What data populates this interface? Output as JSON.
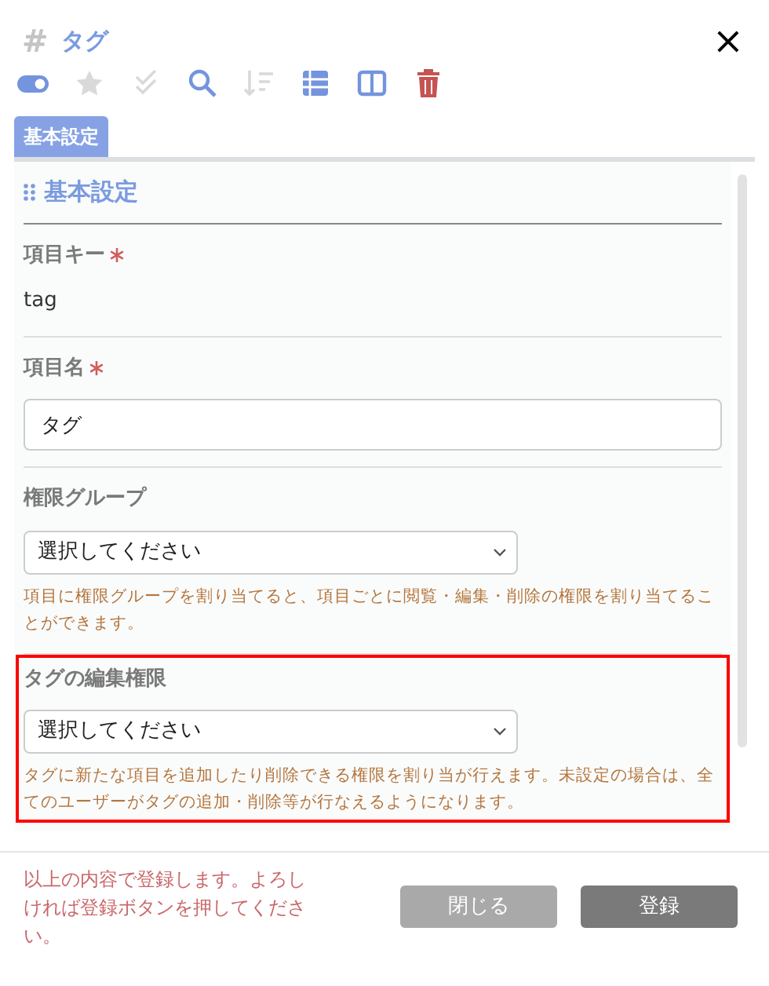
{
  "header": {
    "symbol": "#",
    "title": "タグ",
    "close": "×"
  },
  "toolbar": [
    {
      "kind": "toggle",
      "enabled": true
    },
    {
      "kind": "star",
      "enabled": false
    },
    {
      "kind": "check",
      "enabled": false
    },
    {
      "kind": "search",
      "enabled": true
    },
    {
      "kind": "sort",
      "enabled": false
    },
    {
      "kind": "list",
      "enabled": true
    },
    {
      "kind": "columns",
      "enabled": true
    },
    {
      "kind": "trash",
      "enabled": true
    }
  ],
  "tabs": [
    {
      "label": "基本設定",
      "selected": true
    }
  ],
  "section": {
    "title": "基本設定"
  },
  "fields": [
    {
      "kind": "text",
      "label": "項目キー",
      "required": true,
      "value": "tag",
      "highlighted": false
    },
    {
      "kind": "input",
      "label": "項目名",
      "required": true,
      "value": "タグ",
      "highlighted": false
    },
    {
      "kind": "select",
      "label": "権限グループ",
      "required": false,
      "value": "選択してください",
      "help": "項目に権限グループを割り当てると、項目ごとに閲覧・編集・削除の権限を割り当てることができます。",
      "highlighted": false
    },
    {
      "kind": "select",
      "label": "タグの編集権限",
      "required": false,
      "value": "選択してください",
      "help": "タグに新たな項目を追加したり削除できる権限を割り当が行えます。未設定の場合は、全てのユーザーがタグの追加・削除等が行なえるようになります。",
      "highlighted": true
    }
  ],
  "footer": {
    "message": "以上の内容で登録します。よろしければ登録ボタンを押してください。",
    "buttons": [
      {
        "kind": "close",
        "label": "閉じる"
      },
      {
        "kind": "submit",
        "label": "登録"
      }
    ]
  }
}
